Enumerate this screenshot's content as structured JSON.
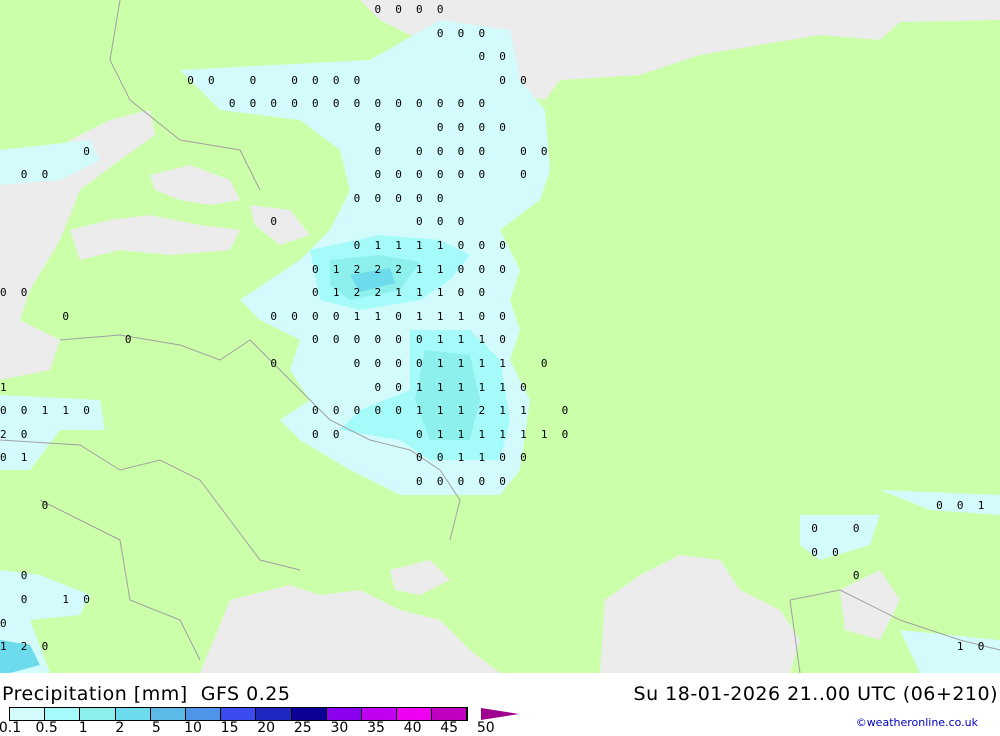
{
  "title": "Precipitation [mm]  GFS 0.25",
  "datetime": "Su 18-01-2026 21..00 UTC (06+210)",
  "credit": "©weatheronline.co.uk",
  "colors": {
    "land": "#ccffaa",
    "sea": "#ececec",
    "border": "#a0a0a0",
    "precip_light": "#d4fbfb",
    "precip_1": "#a5fafa",
    "precip_2": "#8ef0ec",
    "precip_3": "#6cdbeb"
  },
  "legend": {
    "ticks": [
      "0.1",
      "0.5",
      "1",
      "2",
      "5",
      "10",
      "15",
      "20",
      "25",
      "30",
      "35",
      "40",
      "45",
      "50"
    ],
    "colors": [
      "#d4fbfb",
      "#a5fafa",
      "#8ef0ec",
      "#6cdbeb",
      "#5bbbe6",
      "#4e94e8",
      "#3a4cf0",
      "#1e28c0",
      "#0a0096",
      "#8c00f0",
      "#c000f0",
      "#f000f0",
      "#c000c0"
    ]
  },
  "grid_values": [
    "                  0000                          ",
    "                     000                        ",
    "                       00                       ",
    "         00 0 0000      00                      ",
    "           0000000000000                        ",
    "                  0  0000                       ",
    "    0             0 0000 00                     ",
    " 00               000000 0                      ",
    "                 00000                          ",
    "             0      000                         ",
    "                 01111000                       ",
    "               0122211000                       ",
    "00             012211100                        ",
    "   0         000011011100                       ",
    "      0        0000001110                       ",
    "             0   00001111 0                     ",
    "1                 00111110                      ",
    "00110          00000111211 0                    ",
    "20             00   01111110                    ",
    "01                  001100                      ",
    "                    00000                       ",
    "  0                                          001",
    "                                       0 0      ",
    "                                       00       ",
    " 0                                       0      ",
    " 0 10                                           ",
    "0                                               ",
    "120                                           10"
  ]
}
